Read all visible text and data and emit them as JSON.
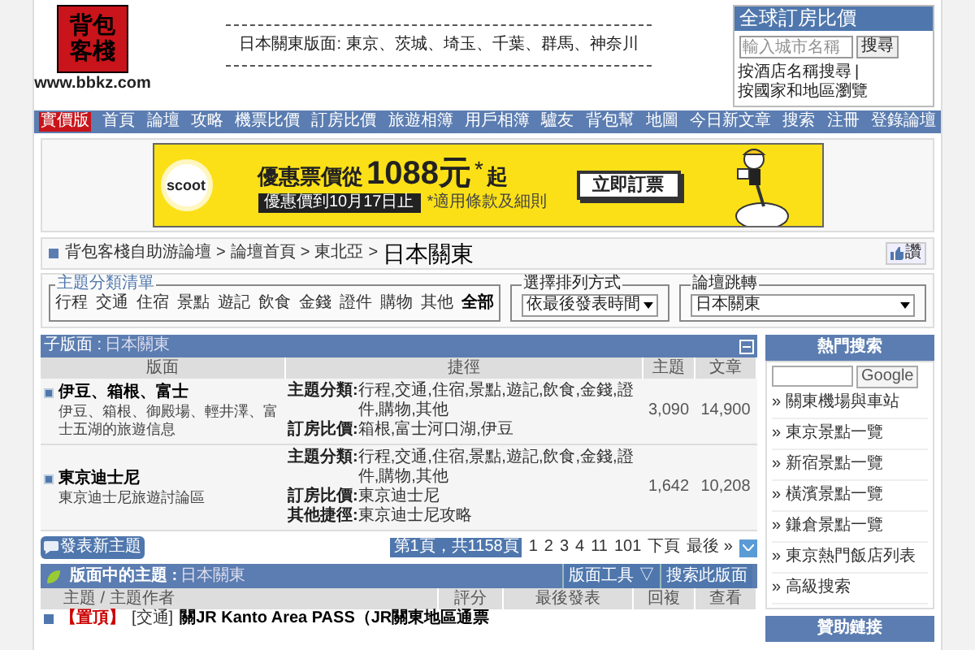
{
  "logo": {
    "line_1": "背包",
    "line_2": "客棧",
    "url": "www.bbkz.com"
  },
  "header_notice": "日本關東版面: 東京、茨城、埼玉、千葉、群馬、神奈川",
  "hotel_search": {
    "title": "全球訂房比價",
    "placeholder": "輸入城市名稱",
    "button": "搜尋",
    "link_1": "按酒店名稱搜尋",
    "separator": "|",
    "link_2": "按國家和地區瀏覽"
  },
  "nav": [
    {
      "label": "實價版",
      "kind": "badge"
    },
    {
      "label": "首頁",
      "kind": "link"
    },
    {
      "label": "論壇",
      "kind": "link"
    },
    {
      "label": "攻略",
      "kind": "link"
    },
    {
      "label": "機票比價",
      "kind": "link"
    },
    {
      "label": "訂房比價",
      "kind": "link"
    },
    {
      "label": "旅遊相簿",
      "kind": "link"
    },
    {
      "label": "用戶相簿",
      "kind": "link"
    },
    {
      "label": "驢友",
      "kind": "link"
    },
    {
      "label": "背包幫",
      "kind": "link"
    },
    {
      "label": "地圖",
      "kind": "link"
    },
    {
      "label": "今日新文章",
      "kind": "link"
    },
    {
      "label": "搜索",
      "kind": "link"
    },
    {
      "label": "注冊",
      "kind": "link"
    },
    {
      "label": "登錄論壇",
      "kind": "link"
    }
  ],
  "ad": {
    "brand": "scoot",
    "headline": "優惠票價從",
    "price": "1088元",
    "asterisk": "*",
    "suffix": "起",
    "deadline": "優惠價到10月17日止",
    "terms": "*適用條款及細則",
    "cta": "立即訂票"
  },
  "breadcrumb": [
    {
      "kind": "link",
      "text": "背包客棧自助游論壇"
    },
    {
      "kind": "sep",
      "text": ">"
    },
    {
      "kind": "link",
      "text": "論壇首頁"
    },
    {
      "kind": "sep",
      "text": ">"
    },
    {
      "kind": "link",
      "text": "東北亞"
    },
    {
      "kind": "sep",
      "text": ">"
    },
    {
      "kind": "current",
      "text": "日本關東"
    }
  ],
  "like_button": "讚",
  "category_filter": {
    "legend": "主題分類清單",
    "items": [
      {
        "label": "行程",
        "selected": false
      },
      {
        "label": "交通",
        "selected": false
      },
      {
        "label": "住宿",
        "selected": false
      },
      {
        "label": "景點",
        "selected": false
      },
      {
        "label": "遊記",
        "selected": false
      },
      {
        "label": "飲食",
        "selected": false
      },
      {
        "label": "金錢",
        "selected": false
      },
      {
        "label": "證件",
        "selected": false
      },
      {
        "label": "購物",
        "selected": false
      },
      {
        "label": "其他",
        "selected": false
      },
      {
        "label": "全部",
        "selected": true
      }
    ]
  },
  "sort_filter": {
    "legend": "選擇排列方式",
    "value": "依最後發表時間"
  },
  "forum_jump": {
    "legend": "論壇跳轉",
    "value": "日本關東"
  },
  "subforums": {
    "title": "子版面 :",
    "subtitle": "日本關東",
    "columns": [
      "版面",
      "捷徑",
      "主題",
      "文章"
    ],
    "rows": [
      {
        "name": "伊豆、箱根、富士",
        "description": "伊豆、箱根、御殿場、輕井澤、富士五湖的旅遊信息",
        "shortcuts": [
          {
            "label": "主題分類:",
            "value": "行程,交通,住宿,景點,遊記,飲食,金錢,證件,購物,其他"
          },
          {
            "label": "訂房比價:",
            "value": "箱根,富士河口湖,伊豆"
          }
        ],
        "topics": "3,090",
        "posts": "14,900"
      },
      {
        "name": "東京迪士尼",
        "description": "東京迪士尼旅遊討論區",
        "shortcuts": [
          {
            "label": "主題分類:",
            "value": "行程,交通,住宿,景點,遊記,飲食,金錢,證件,購物,其他"
          },
          {
            "label": "訂房比價:",
            "value": "東京迪士尼"
          },
          {
            "label": "其他捷徑:",
            "value": "東京迪士尼攻略"
          }
        ],
        "topics": "1,642",
        "posts": "10,208"
      }
    ]
  },
  "new_topic_button": "發表新主題",
  "pagination": {
    "summary": "第1頁，共1158頁",
    "pages": [
      "1",
      "2",
      "3",
      "4",
      "11",
      "101"
    ],
    "next": "下頁",
    "last": "最後 »"
  },
  "topics": {
    "title": "版面中的主題 :",
    "subtitle": "日本關東",
    "tools": [
      "版面工具 ▽",
      "搜索此版面"
    ],
    "columns": [
      "主題 / 主題作者",
      "評分",
      "最後發表",
      "回複",
      "查看"
    ],
    "rows": [
      {
        "tag": "【置頂】",
        "category": "[交通]",
        "title": "關JR Kanto Area PASS（JR關東地區通票"
      }
    ]
  },
  "sidebar": {
    "hot_title": "熱門搜索",
    "search_button": "Google",
    "links": [
      "» 關東機場與車站",
      "» 東京景點一覽",
      "» 新宿景點一覽",
      "» 橫濱景點一覽",
      "» 鎌倉景點一覽",
      "» 東京熱門飯店列表",
      "» 高級搜索"
    ],
    "sponsor_title": "贊助鏈接"
  }
}
